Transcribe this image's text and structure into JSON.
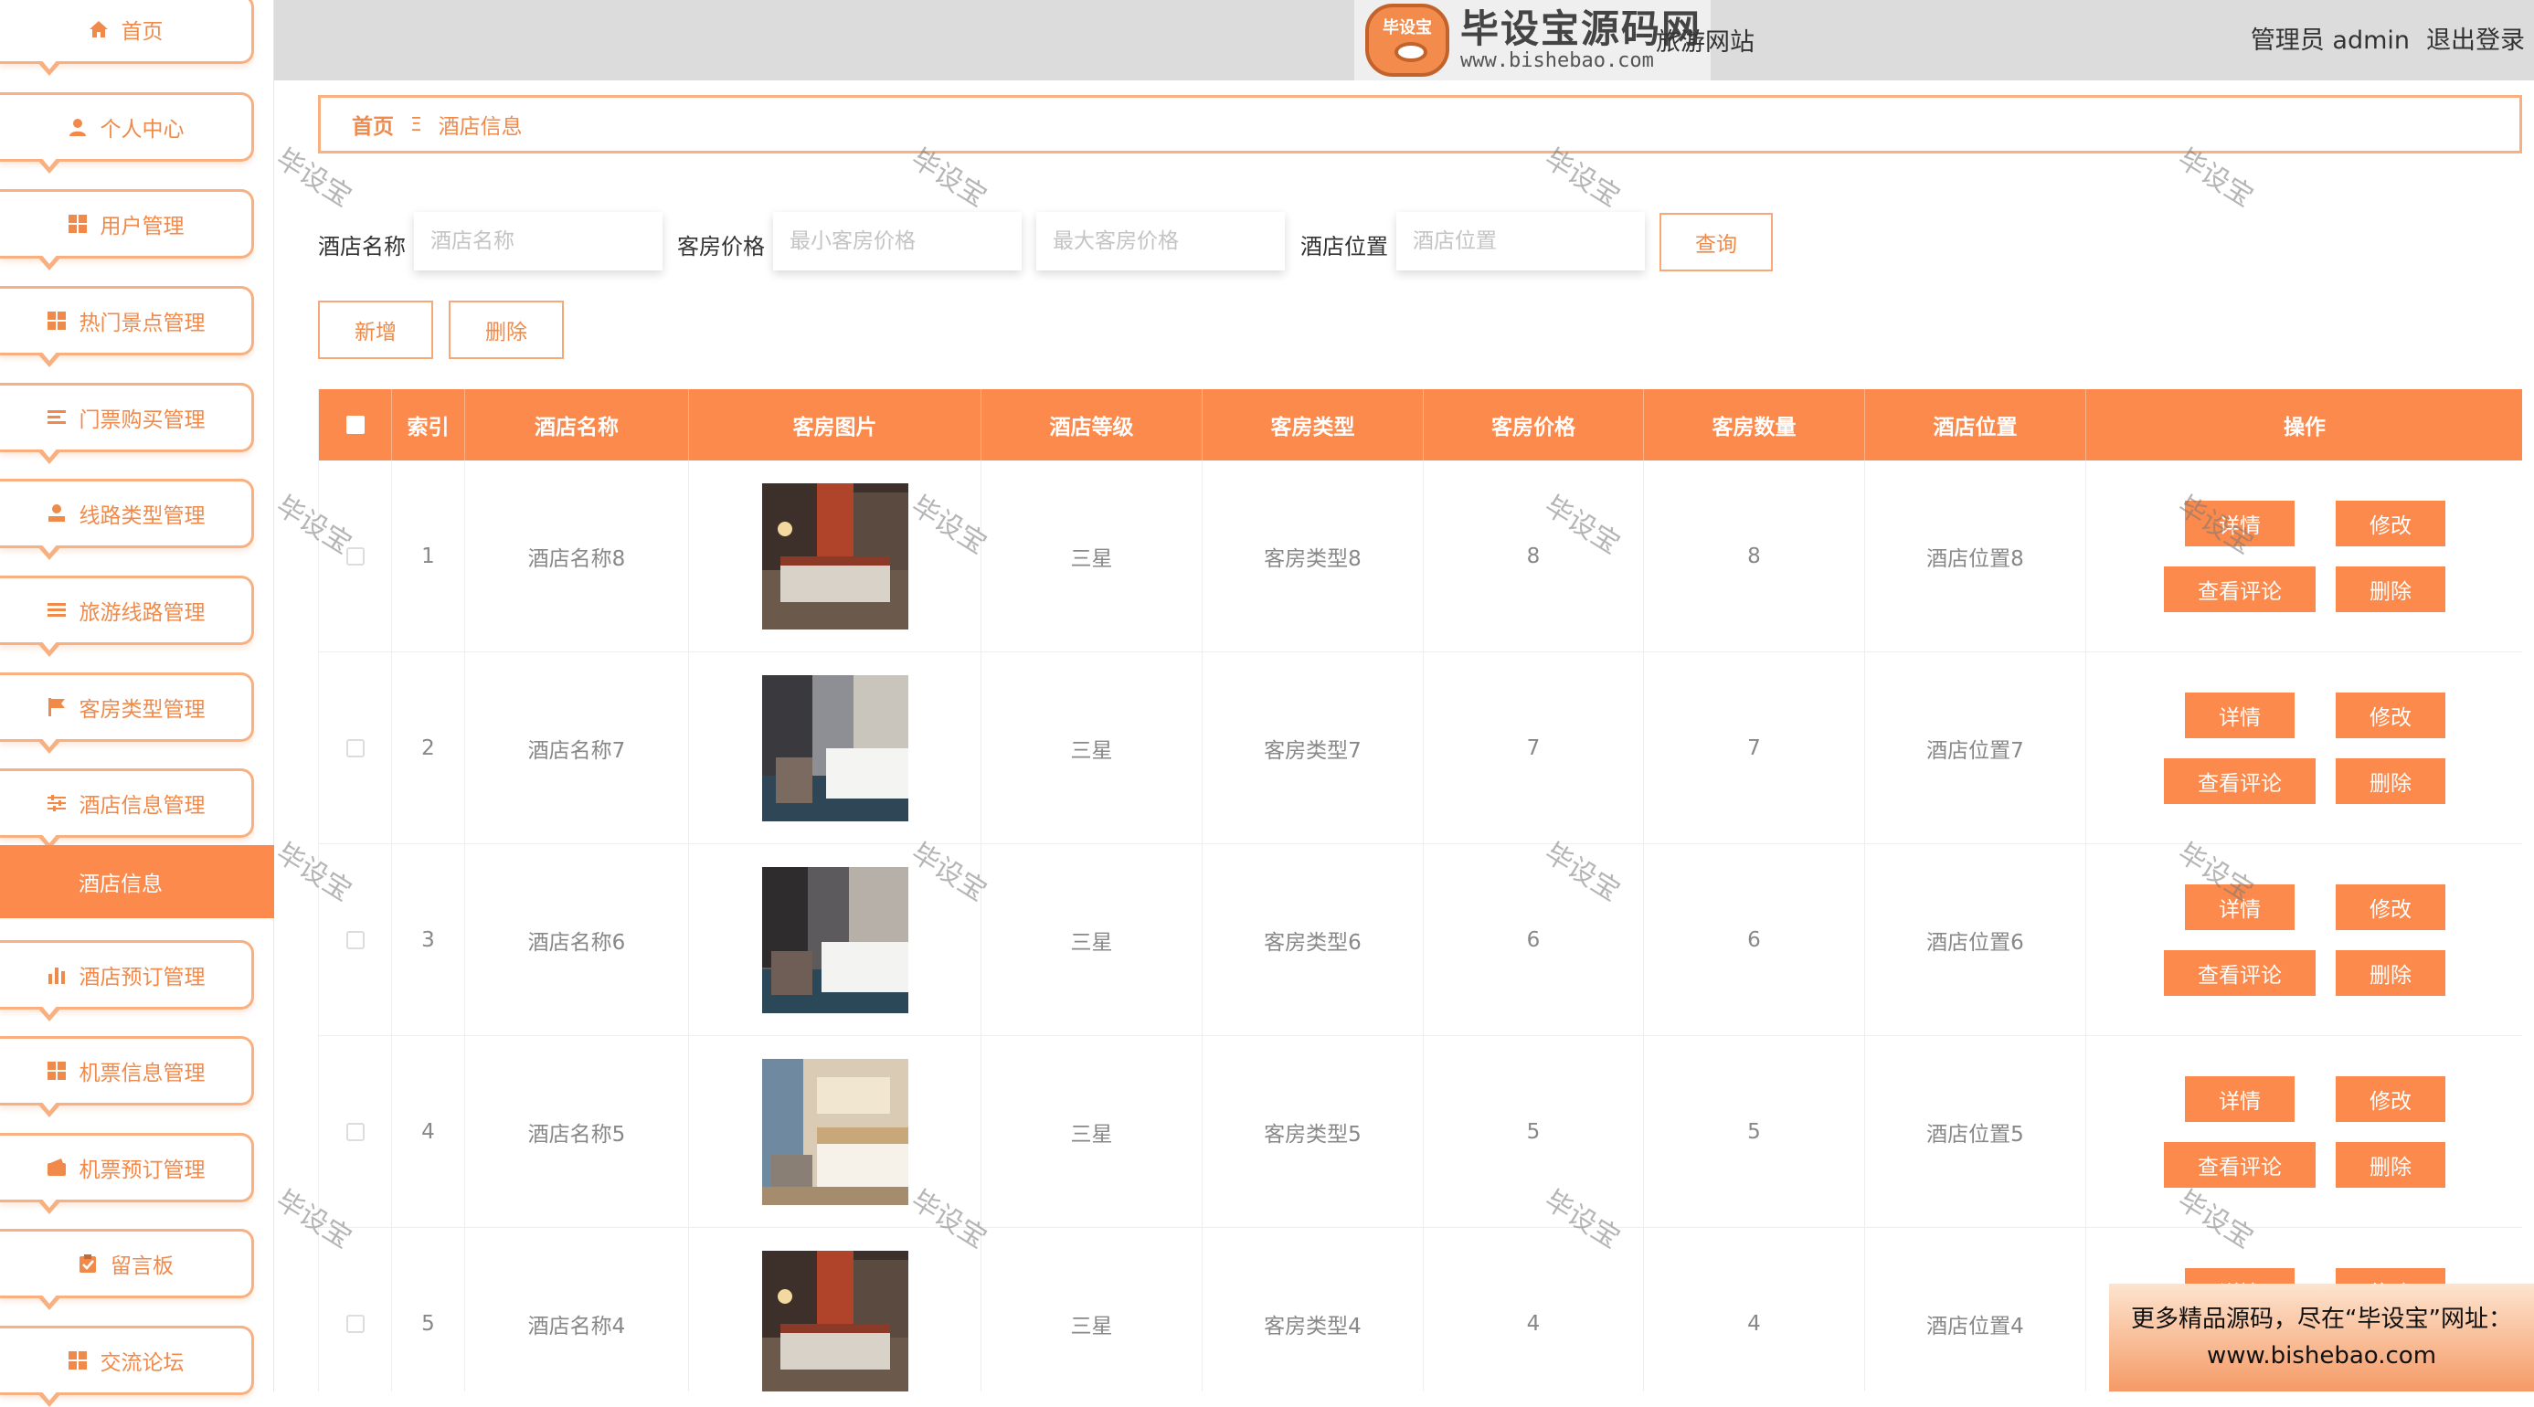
{
  "sidebar": {
    "items": [
      {
        "label": "首页",
        "icon": "home-icon"
      },
      {
        "label": "个人中心",
        "icon": "user-icon"
      },
      {
        "label": "用户管理",
        "icon": "grid-icon"
      },
      {
        "label": "热门景点管理",
        "icon": "grid-icon"
      },
      {
        "label": "门票购买管理",
        "icon": "list-icon"
      },
      {
        "label": "线路类型管理",
        "icon": "person-icon"
      },
      {
        "label": "旅游线路管理",
        "icon": "list-icon"
      },
      {
        "label": "客房类型管理",
        "icon": "flag-icon"
      },
      {
        "label": "酒店信息管理",
        "icon": "sliders-icon"
      },
      {
        "label": "酒店预订管理",
        "icon": "bar-chart-icon"
      },
      {
        "label": "机票信息管理",
        "icon": "grid-icon"
      },
      {
        "label": "机票预订管理",
        "icon": "wallet-icon"
      },
      {
        "label": "留言板",
        "icon": "clipboard-icon"
      },
      {
        "label": "交流论坛",
        "icon": "grid-icon"
      }
    ],
    "active_sub": "酒店信息"
  },
  "header": {
    "logo_badge": "毕设宝",
    "logo_title": "毕设宝源码网",
    "logo_url": "www.bishebao.com",
    "site_title": "旅游网站",
    "user_label": "管理员 admin",
    "logout": "退出登录"
  },
  "breadcrumb": {
    "home": "首页",
    "separator": "Ξ",
    "current": "酒店信息"
  },
  "search": {
    "name_label": "酒店名称",
    "name_placeholder": "酒店名称",
    "price_label": "客房价格",
    "min_placeholder": "最小客房价格",
    "max_placeholder": "最大客房价格",
    "location_label": "酒店位置",
    "location_placeholder": "酒店位置",
    "query_button": "查询"
  },
  "actions": {
    "add": "新增",
    "delete": "删除"
  },
  "table": {
    "headers": [
      "索引",
      "酒店名称",
      "客房图片",
      "酒店等级",
      "客房类型",
      "客房价格",
      "客房数量",
      "酒店位置",
      "操作"
    ],
    "rows": [
      {
        "index": "1",
        "name": "酒店名称8",
        "level": "三星",
        "room_type": "客房类型8",
        "price": "8",
        "count": "8",
        "location": "酒店位置8"
      },
      {
        "index": "2",
        "name": "酒店名称7",
        "level": "三星",
        "room_type": "客房类型7",
        "price": "7",
        "count": "7",
        "location": "酒店位置7"
      },
      {
        "index": "3",
        "name": "酒店名称6",
        "level": "三星",
        "room_type": "客房类型6",
        "price": "6",
        "count": "6",
        "location": "酒店位置6"
      },
      {
        "index": "4",
        "name": "酒店名称5",
        "level": "三星",
        "room_type": "客房类型5",
        "price": "5",
        "count": "5",
        "location": "酒店位置5"
      },
      {
        "index": "5",
        "name": "酒店名称4",
        "level": "三星",
        "room_type": "客房类型4",
        "price": "4",
        "count": "4",
        "location": "酒店位置4"
      }
    ],
    "row_buttons": {
      "detail": "详情",
      "edit": "修改",
      "comments": "查看评论",
      "delete": "删除"
    }
  },
  "watermark": "毕设宝",
  "promo": {
    "line1": "更多精品源码，尽在“毕设宝”网址：",
    "line2": "www.bishebao.com"
  },
  "colors": {
    "accent": "#fb8a4c",
    "border": "#f8b080"
  }
}
